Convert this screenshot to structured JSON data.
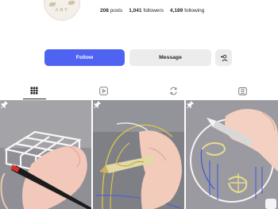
{
  "profile": {
    "avatar_text": "ART",
    "stats": [
      {
        "value": "208",
        "label": "posts"
      },
      {
        "value": "1,041",
        "label": "followers"
      },
      {
        "value": "4,189",
        "label": "following"
      }
    ]
  },
  "actions": {
    "follow_label": "Follow",
    "message_label": "Message"
  },
  "tabs": [
    {
      "icon": "grid-icon",
      "active": true
    },
    {
      "icon": "reels-icon",
      "active": false
    },
    {
      "icon": "reposts-icon",
      "active": false
    },
    {
      "icon": "tagged-icon",
      "active": false
    }
  ],
  "posts": [
    {
      "subject": "grid-box-drawing",
      "pinned": true
    },
    {
      "subject": "arch-drawing",
      "pinned": true
    },
    {
      "subject": "wreath-drawing",
      "pinned": true
    }
  ],
  "colors": {
    "accent": "#4f63f2",
    "button_gray": "#ececec",
    "text": "#262626"
  }
}
